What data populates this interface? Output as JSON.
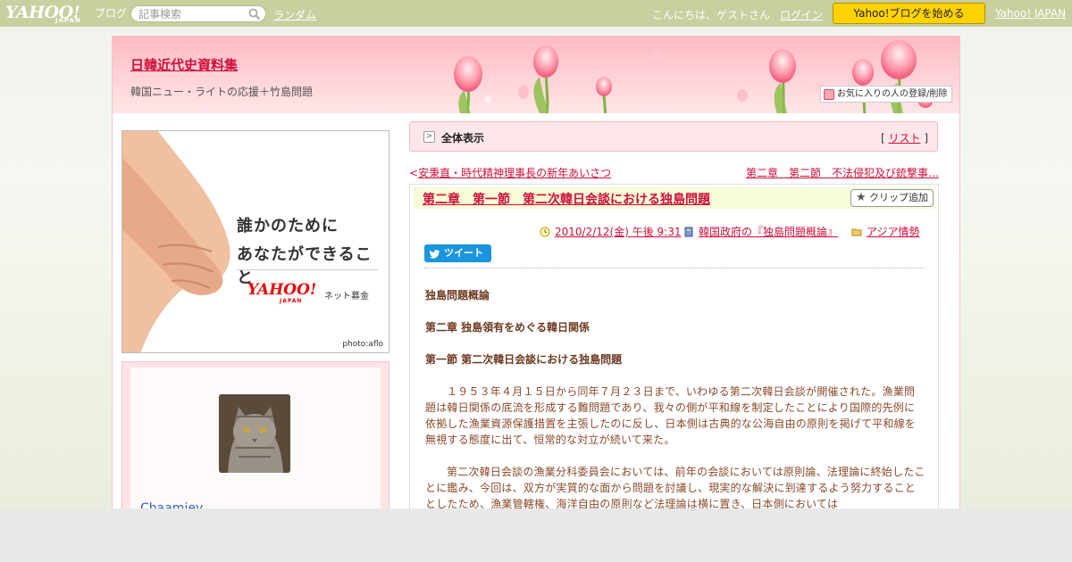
{
  "topbar": {
    "logo_yahoo": "YAHOO!",
    "logo_japan": "JAPAN",
    "logo_blog": "ブログ",
    "search_placeholder": "記事検索",
    "random_link": "ランダム",
    "greeting": "こんにちは、ゲストさん",
    "login_link": "ログイン",
    "start_button": "Yahoo!ブログを始める",
    "yahoo_japan_link": "Yahoo! JAPAN"
  },
  "header": {
    "blog_title": "日韓近代史資料集",
    "blog_description": "韓国ニュー・ライトの応援＋竹島問題",
    "favorite_button": "お気に入りの人の登録/削除"
  },
  "banner": {
    "line1": "誰かのために",
    "line2": "あなたができること",
    "brand": "YAHOO!",
    "brand_japan": "JAPAN",
    "brand_sub": "ネット募金",
    "photo_credit": "photo:aflo"
  },
  "profile": {
    "username": "Chaamiey"
  },
  "nav": {
    "label": "全体表示",
    "list_open": "[",
    "list_link": "リスト",
    "list_close": "]"
  },
  "pager": {
    "prev_arrow": "<",
    "prev": "安秉直・時代精神理事長の新年あいさつ",
    "next": "第二章　第二節　不法侵犯及び銃撃事…",
    "next_arrow": ">"
  },
  "entry": {
    "title": "第二章　第一節　第二次韓日会談における独島問題",
    "clip_button": "クリップ追加",
    "date": "2010/2/12(金) 午後 9:31",
    "category": "韓国政府の『独島問題概論』",
    "folder": "アジア情勢",
    "tweet_button": "ツイート",
    "heading1": "独島問題概論",
    "heading2": "第二章 独島領有をめぐる韓日関係",
    "heading3": "第一節 第二次韓日会談における独島問題",
    "paragraph1": "１９５３年４月１５日から同年７月２３日まで、いわゆる第二次韓日会談が開催された。漁業問題は韓日関係の底流を形成する難問題であり、我々の側が平和線を制定したことにより国際的先例に依拠した漁業資源保護措置を主張したのに反し、日本側は古典的な公海自由の原則を掲げて平和線を無視する態度に出て、恒常的な対立が続いて来た。",
    "paragraph2": "第二次韓日会談の漁業分科委員会においては、前年の会談においては原則論、法理論に終始したことに鑑み、今回は、双方が実質的な面から問題を討議し、現実的な解決に到達するよう努力することとしたため、漁業管轄権、海洋自由の原則など法理論は横に置き、日本側においては"
  },
  "colors": {
    "topbar": "#c9cf9e",
    "accent_link": "#d0103a",
    "start_button": "#ffd200",
    "header_pink": "#ffb9c2",
    "body_text": "#8a4a2c",
    "tweet": "#1b95e0"
  }
}
